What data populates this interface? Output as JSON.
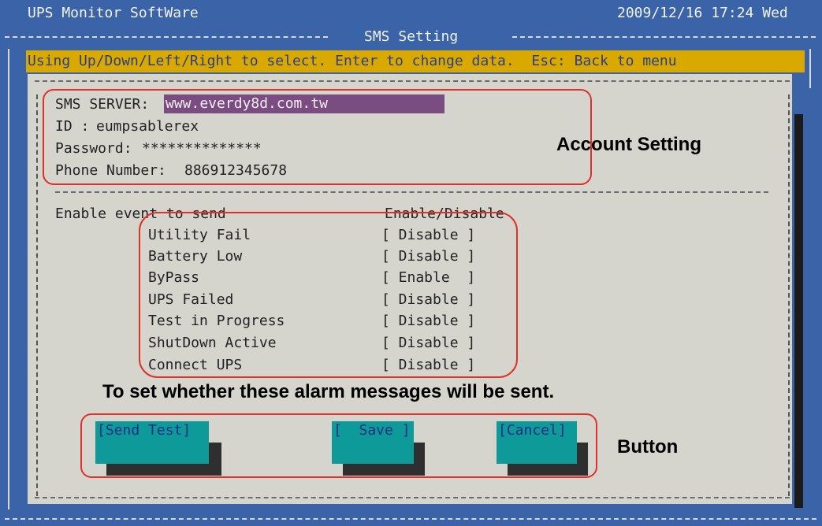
{
  "header": {
    "app_title": "UPS Monitor SoftWare",
    "datetime": "2009/12/16 17:24 Wed",
    "screen_title": "SMS Setting"
  },
  "hint": "Using Up/Down/Left/Right to select. Enter to change data.  Esc: Back to menu",
  "account": {
    "server_label": "SMS SERVER:",
    "server_value": "www.everdy8d.com.tw",
    "id_label": "ID :",
    "id_value": "eumpsablerex",
    "password_label": "Password:",
    "password_value": "**************",
    "phone_label": "Phone Number:",
    "phone_value": "886912345678"
  },
  "events": {
    "header_label": "Enable event to send",
    "header_state": "Enable/Disable",
    "items": [
      {
        "name": "Utility Fail",
        "state": "[ Disable ]"
      },
      {
        "name": "Battery Low",
        "state": "[ Disable ]"
      },
      {
        "name": "ByPass",
        "state": "[ Enable  ]"
      },
      {
        "name": "UPS Failed",
        "state": "[ Disable ]"
      },
      {
        "name": "Test in Progress",
        "state": "[ Disable ]"
      },
      {
        "name": "ShutDown Active",
        "state": "[ Disable ]"
      },
      {
        "name": "Connect UPS",
        "state": "[ Disable ]"
      }
    ]
  },
  "buttons": {
    "send_test": "[Send Test]",
    "save": "[  Save ]",
    "cancel": "[Cancel]"
  },
  "annotations": {
    "account_setting": "Account Setting",
    "alarm_note": "To set whether these alarm messages will be sent.",
    "button": "Button"
  },
  "colors": {
    "background": "#3a63a8",
    "panel": "#d5d5cd",
    "hint_bar": "#d9a900",
    "highlight": "#7a4c82",
    "button": "#0f9a9a",
    "annotation": "#e0302a"
  }
}
